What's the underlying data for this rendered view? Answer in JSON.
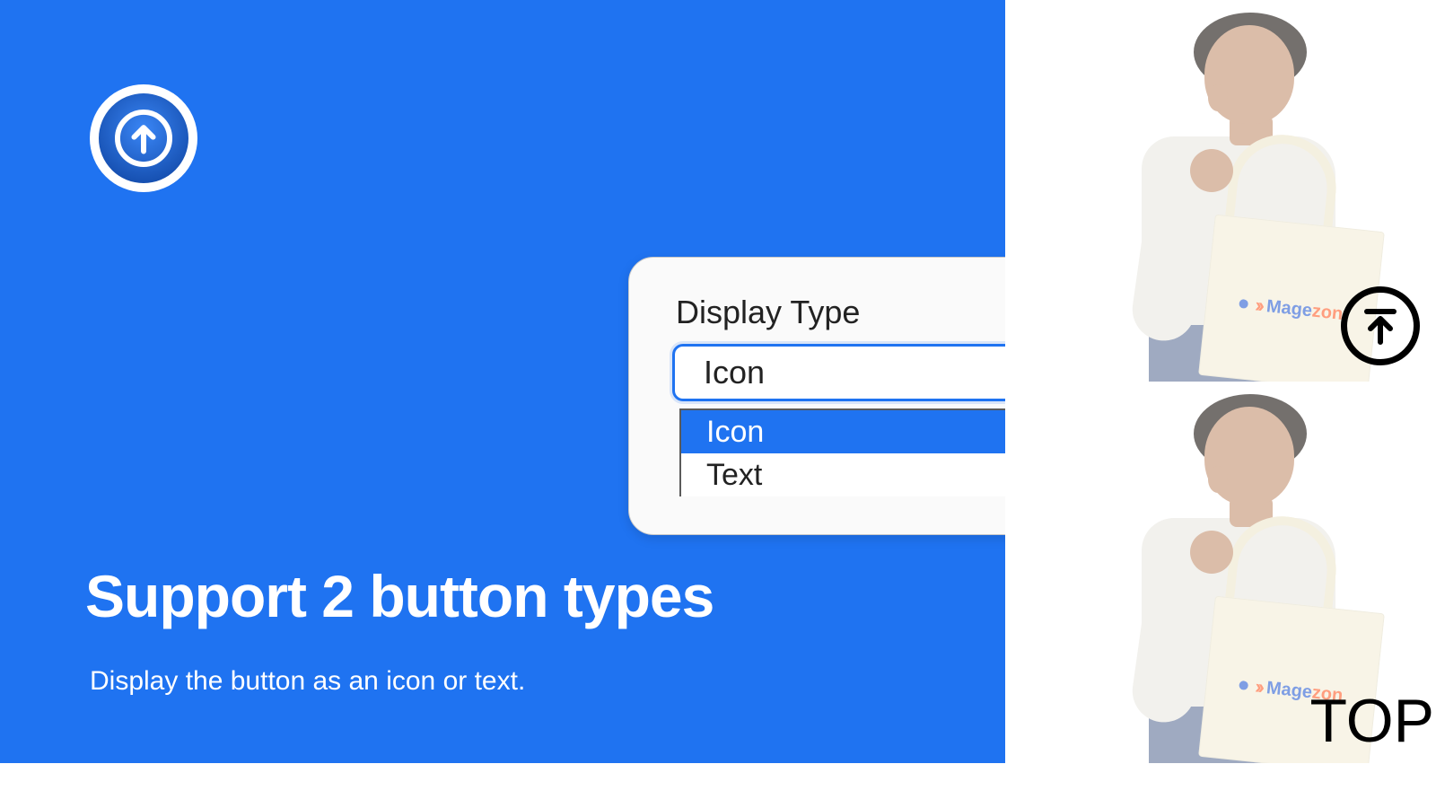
{
  "hero": {
    "title": "Support 2 button types",
    "subtitle": "Display the button as an icon or text."
  },
  "settings": {
    "label": "Display Type",
    "selected_value": "Icon",
    "options": [
      "Icon",
      "Text"
    ]
  },
  "preview": {
    "bag_brand_part1": "Mage",
    "bag_brand_part2": "zon",
    "scroll_text_label": "TOP"
  }
}
